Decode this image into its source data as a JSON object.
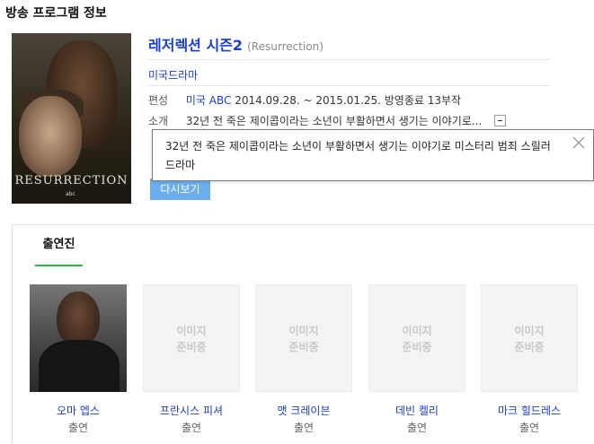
{
  "section_title": "방송 프로그램 정보",
  "poster": {
    "title_text": "RESURRECTION",
    "network_text": "abc"
  },
  "program": {
    "title": "레저렉션 시즌2",
    "title_en": "(Resurrection)",
    "genre": "미국드라마",
    "broadcast_label": "편성",
    "country": "미국",
    "channel": "ABC",
    "period": "2014.09.28. ~ 2015.01.25.",
    "status": "방영종료",
    "episodes": "13부작",
    "summary_label": "소개",
    "summary_short": "32년 전 죽은 제이콥이라는 소년이 부활하면서 생기는 이야기로...",
    "rewatch_label": "다시보기"
  },
  "popup": {
    "text": "32년 전 죽은 제이콥이라는 소년이 부활하면서 생기는 이야기로 미스터리 범죄 스릴러 드라마"
  },
  "cast": {
    "tab_label": "출연진",
    "placeholder_text": "이미지\n준비중",
    "members": [
      {
        "name": "오마 엡스",
        "role": "출연"
      },
      {
        "name": "프란시스 피셔",
        "role": "출연"
      },
      {
        "name": "맷 크레이븐",
        "role": "출연"
      },
      {
        "name": "데빈 켈리",
        "role": "출연"
      },
      {
        "name": "마크 힐드레스",
        "role": "출연"
      }
    ]
  },
  "colors": {
    "link": "#1a3ec8",
    "accent_green": "#2cb34a",
    "button": "#6aaef0"
  }
}
